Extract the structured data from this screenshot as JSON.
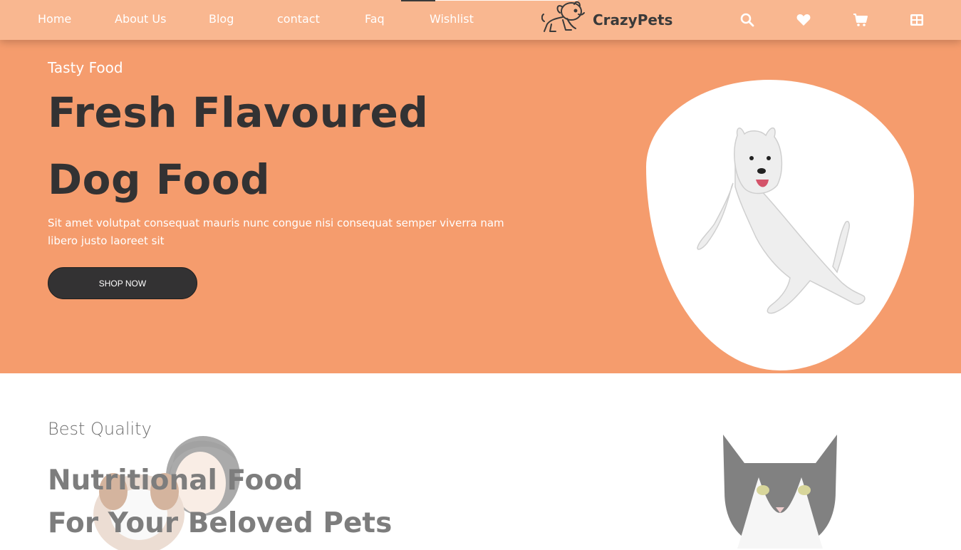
{
  "nav": {
    "items": [
      {
        "label": "Home"
      },
      {
        "label": "About Us"
      },
      {
        "label": "Blog"
      },
      {
        "label": "contact"
      },
      {
        "label": "Faq"
      },
      {
        "label": "Wishlist"
      }
    ]
  },
  "logo": {
    "text": "CrazyPets"
  },
  "header_icons": [
    "search-icon",
    "heart-icon",
    "cart-icon",
    "grid-icon"
  ],
  "hero": {
    "kicker": "Tasty Food",
    "title_line1": "Fresh Flavoured",
    "title_line2": "Dog Food",
    "description": "Sit amet volutpat consequat mauris nunc congue nisi consequat semper viverra nam libero justo laoreet sit",
    "cta_label": "SHOP NOW"
  },
  "section2": {
    "kicker": "Best Quality",
    "title_line1": "Nutritional Food",
    "title_line2": "For Your Beloved Pets"
  },
  "colors": {
    "header_bg": "#f9b790",
    "hero_bg": "#f59c6d",
    "dark": "#333233",
    "white": "#ffffff"
  }
}
